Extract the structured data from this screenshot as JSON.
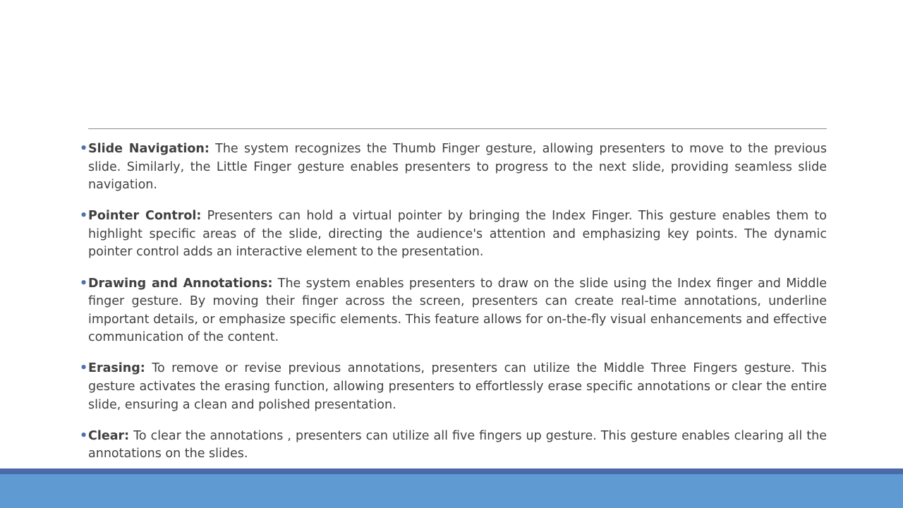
{
  "bullet_glyph": "•",
  "colors": {
    "text": "#404040",
    "bullet": "#4a72b0",
    "rule": "#8c8c8c",
    "footer_dark": "#4a6aaa",
    "footer_band": "#5f9ad2"
  },
  "items": [
    {
      "term": "Slide Navigation:",
      "text": " The system recognizes the Thumb Finger gesture, allowing presenters to move to the previous slide. Similarly, the Little Finger gesture enables presenters to progress to the next slide, providing seamless slide navigation."
    },
    {
      "term": "Pointer Control:",
      "text": " Presenters can hold a virtual pointer by bringing the Index Finger. This gesture enables them to highlight specific areas of the slide, directing the audience's attention and emphasizing key points. The dynamic pointer control adds an interactive element to the presentation."
    },
    {
      "term": "Drawing and Annotations:",
      "text": " The system enables presenters to draw on the slide using the Index finger and Middle finger gesture. By moving their finger across the screen, presenters can create real-time annotations, underline important details, or emphasize specific elements. This feature allows for on-the-fly visual enhancements and effective communication of the content."
    },
    {
      "term": "Erasing:",
      "text": " To remove or revise previous annotations, presenters can utilize the Middle Three Fingers gesture. This gesture activates the erasing function, allowing presenters to effortlessly erase specific annotations or clear the entire slide, ensuring a clean and polished presentation."
    },
    {
      "term": "Clear:",
      "text": " To clear the annotations , presenters can utilize all five fingers up gesture. This gesture enables clearing all the annotations on the slides."
    }
  ]
}
